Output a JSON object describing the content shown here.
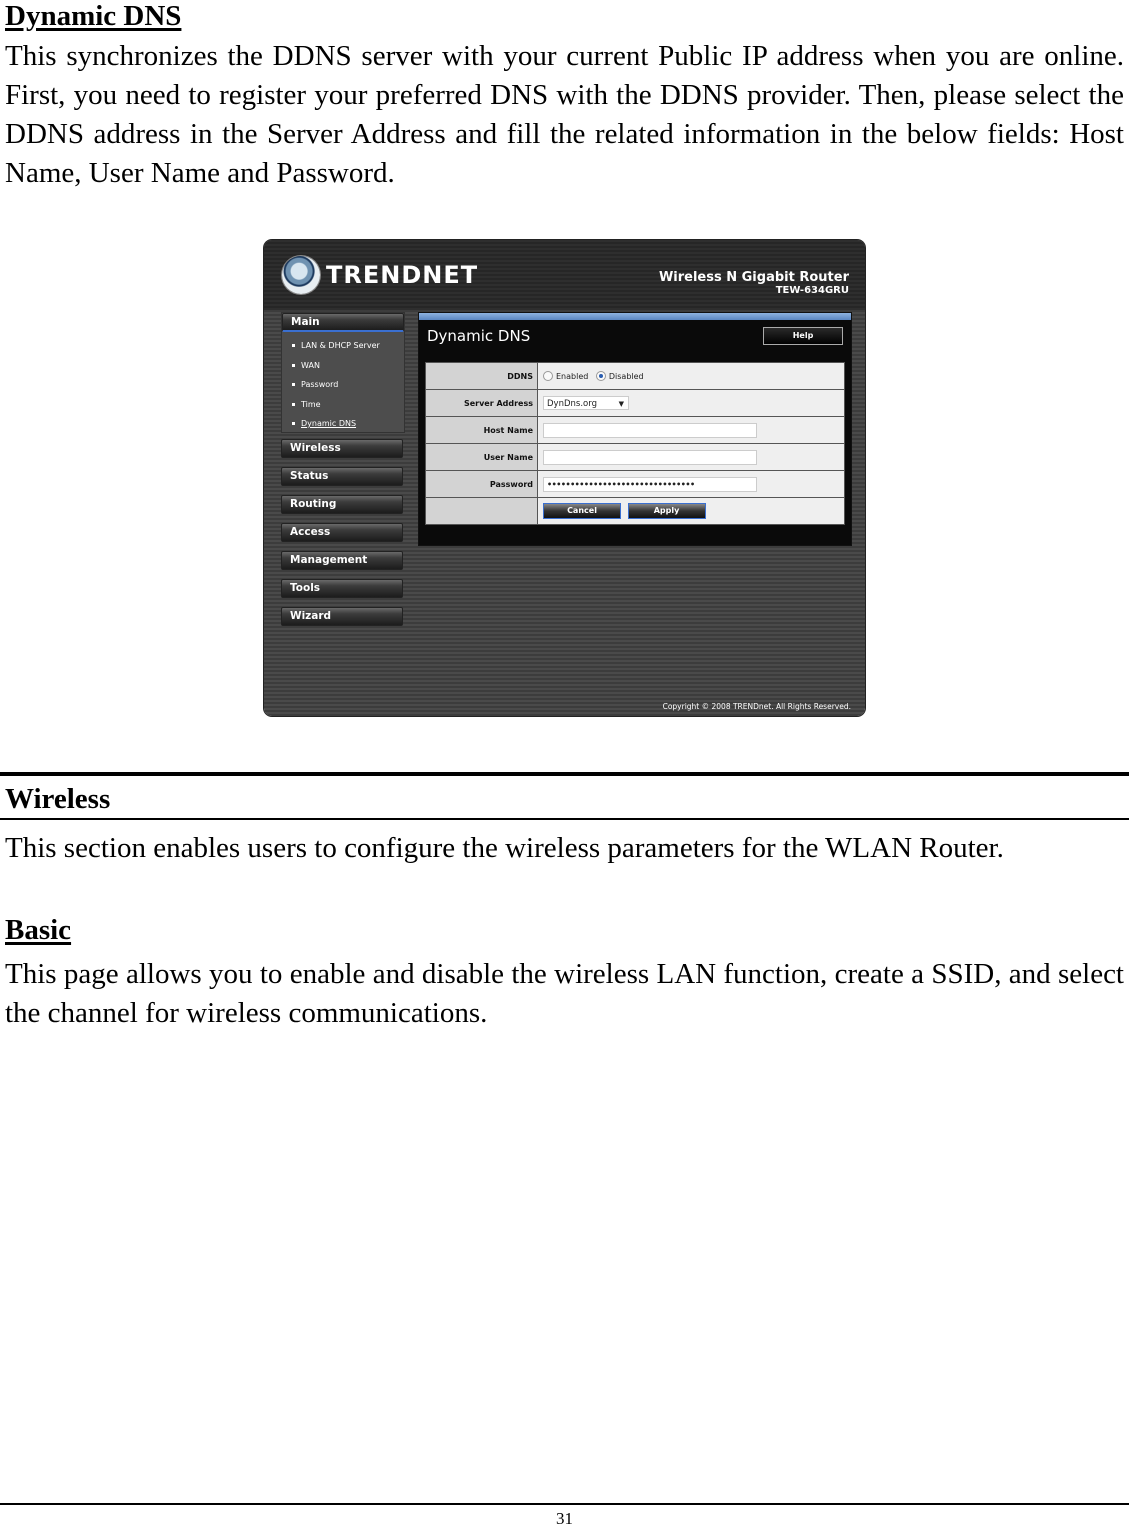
{
  "document": {
    "section1": {
      "heading": "Dynamic DNS",
      "paragraph": "This synchronizes the DDNS server with your current Public IP address when you are online.  First, you need to register your preferred DNS with the DDNS provider. Then, please select the DDNS address in the Server Address and fill the related information in the below fields: Host Name, User Name and Password."
    },
    "section2": {
      "heading": "Wireless",
      "paragraph": "This section enables users to configure the wireless parameters for the WLAN Router."
    },
    "section3": {
      "heading": "Basic",
      "paragraph": "This page allows you to enable and disable the wireless LAN function, create a SSID, and select the channel for wireless communications."
    },
    "page_number": "31"
  },
  "router_ui": {
    "brand": "TRENDnet",
    "logo_text": "TRENDNET",
    "product_name": "Wireless N Gigabit Router",
    "product_model": "TEW-634GRU",
    "sidebar": {
      "main_label": "Main",
      "sub_items": [
        {
          "label": "LAN & DHCP Server",
          "active": false
        },
        {
          "label": "WAN",
          "active": false
        },
        {
          "label": "Password",
          "active": false
        },
        {
          "label": "Time",
          "active": false
        },
        {
          "label": "Dynamic DNS",
          "active": true
        }
      ],
      "sections": [
        "Wireless",
        "Status",
        "Routing",
        "Access",
        "Management",
        "Tools",
        "Wizard"
      ]
    },
    "panel": {
      "title": "Dynamic DNS",
      "help_label": "Help",
      "fields": {
        "ddns": {
          "label": "DDNS",
          "options": [
            "Enabled",
            "Disabled"
          ],
          "selected": "Disabled"
        },
        "server_address": {
          "label": "Server Address",
          "value": "DynDns.org"
        },
        "host_name": {
          "label": "Host Name",
          "value": ""
        },
        "user_name": {
          "label": "User Name",
          "value": ""
        },
        "password": {
          "label": "Password",
          "value": "••••••••••••••••••••••••••••••••"
        }
      },
      "cancel_label": "Cancel",
      "apply_label": "Apply"
    },
    "copyright": "Copyright © 2008 TRENDnet. All Rights Reserved."
  }
}
